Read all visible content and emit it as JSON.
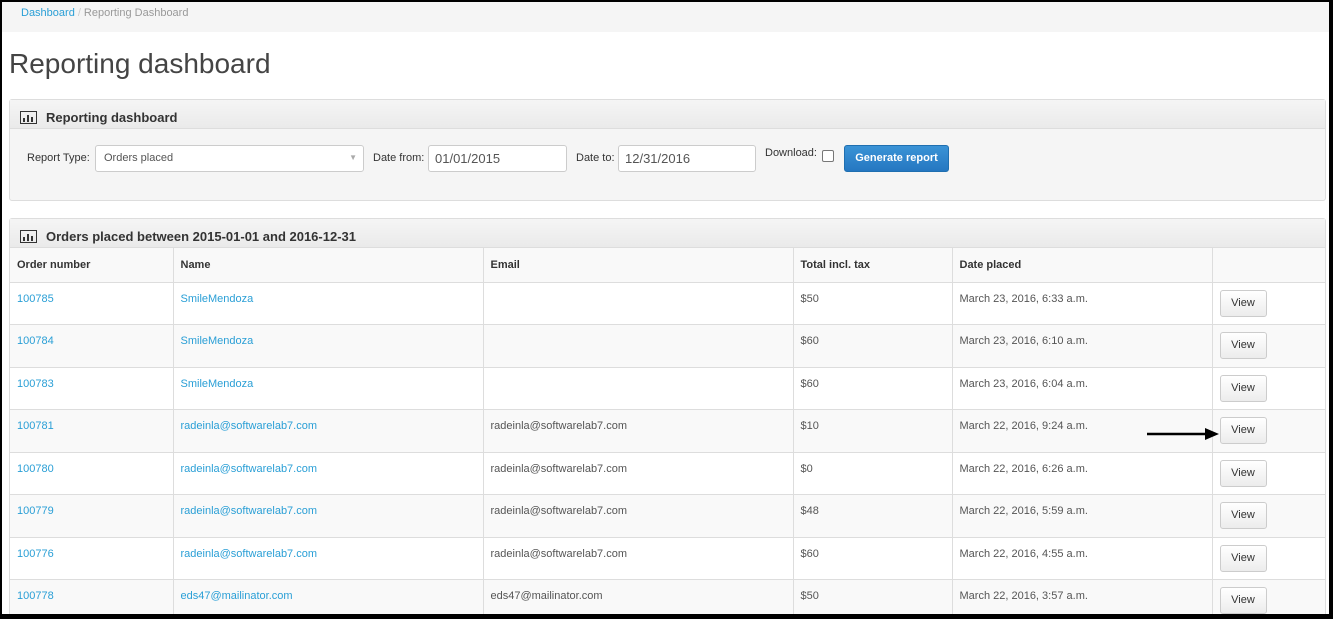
{
  "breadcrumb": {
    "home": "Dashboard",
    "current": "Reporting Dashboard"
  },
  "page_title": "Reporting dashboard",
  "filter_panel": {
    "heading": "Reporting dashboard",
    "report_type_label": "Report Type:",
    "report_type_value": "Orders placed",
    "date_from_label": "Date from:",
    "date_from_value": "01/01/2015",
    "date_to_label": "Date to:",
    "date_to_value": "12/31/2016",
    "download_label": "Download:",
    "generate_label": "Generate report"
  },
  "orders_panel": {
    "heading": "Orders placed between 2015-01-01 and 2016-12-31",
    "columns": [
      "Order number",
      "Name",
      "Email",
      "Total incl. tax",
      "Date placed",
      ""
    ],
    "view_label": "View",
    "rows": [
      {
        "order": "100785",
        "name": "SmileMendoza",
        "email": "",
        "total": "$50",
        "date": "March 23, 2016, 6:33 a.m."
      },
      {
        "order": "100784",
        "name": "SmileMendoza",
        "email": "",
        "total": "$60",
        "date": "March 23, 2016, 6:10 a.m."
      },
      {
        "order": "100783",
        "name": "SmileMendoza",
        "email": "",
        "total": "$60",
        "date": "March 23, 2016, 6:04 a.m."
      },
      {
        "order": "100781",
        "name": "radeinla@softwarelab7.com",
        "email": "radeinla@softwarelab7.com",
        "total": "$10",
        "date": "March 22, 2016, 9:24 a.m."
      },
      {
        "order": "100780",
        "name": "radeinla@softwarelab7.com",
        "email": "radeinla@softwarelab7.com",
        "total": "$0",
        "date": "March 22, 2016, 6:26 a.m."
      },
      {
        "order": "100779",
        "name": "radeinla@softwarelab7.com",
        "email": "radeinla@softwarelab7.com",
        "total": "$48",
        "date": "March 22, 2016, 5:59 a.m."
      },
      {
        "order": "100776",
        "name": "radeinla@softwarelab7.com",
        "email": "radeinla@softwarelab7.com",
        "total": "$60",
        "date": "March 22, 2016, 4:55 a.m."
      },
      {
        "order": "100778",
        "name": "eds47@mailinator.com",
        "email": "eds47@mailinator.com",
        "total": "$50",
        "date": "March 22, 2016, 3:57 a.m."
      }
    ]
  },
  "colors": {
    "link": "#2a9fd6",
    "primary_button": "#2e86cc"
  },
  "icons": {
    "panel_icon": "bar-chart-icon",
    "annotation": "arrow-right-icon"
  }
}
